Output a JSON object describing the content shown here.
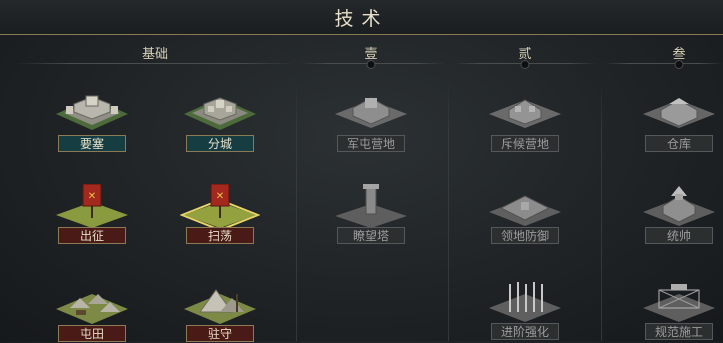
{
  "header": {
    "title": "技术"
  },
  "tiers": [
    {
      "label": "基础"
    },
    {
      "label": "壹"
    },
    {
      "label": "贰"
    },
    {
      "label": "叁"
    }
  ],
  "techs": {
    "fortress": {
      "label": "要塞",
      "icon": "fortress-icon",
      "state": "unlocked"
    },
    "branch_city": {
      "label": "分城",
      "icon": "walled-city-icon",
      "state": "unlocked"
    },
    "expedition": {
      "label": "出征",
      "icon": "war-banner-icon",
      "state": "unlocked"
    },
    "sweep": {
      "label": "扫荡",
      "icon": "war-banner-icon",
      "state": "selected"
    },
    "farming": {
      "label": "屯田",
      "icon": "camp-icon",
      "state": "unlocked"
    },
    "garrison": {
      "label": "驻守",
      "icon": "tent-icon",
      "state": "unlocked"
    },
    "barracks": {
      "label": "军屯营地",
      "icon": "camp-icon",
      "state": "locked"
    },
    "watchtower": {
      "label": "瞭望塔",
      "icon": "watchtower-icon",
      "state": "locked"
    },
    "scout_camp": {
      "label": "斥候营地",
      "icon": "camp-icon",
      "state": "locked"
    },
    "territory_defense": {
      "label": "领地防御",
      "icon": "fortification-icon",
      "state": "locked"
    },
    "advanced_strength": {
      "label": "进阶强化",
      "icon": "spear-rack-icon",
      "state": "locked"
    },
    "warehouse": {
      "label": "仓库",
      "icon": "warehouse-icon",
      "state": "locked"
    },
    "commander": {
      "label": "统帅",
      "icon": "palace-icon",
      "state": "locked"
    },
    "standard_build": {
      "label": "规范施工",
      "icon": "construction-icon",
      "state": "locked"
    }
  },
  "colors": {
    "unlocked_label_teal": "#163d42",
    "unlocked_label_red": "#4a1a16",
    "locked_label": "#2c2f30",
    "selected_glow": "#e8d36a",
    "accent_gold": "#8a7a55"
  }
}
